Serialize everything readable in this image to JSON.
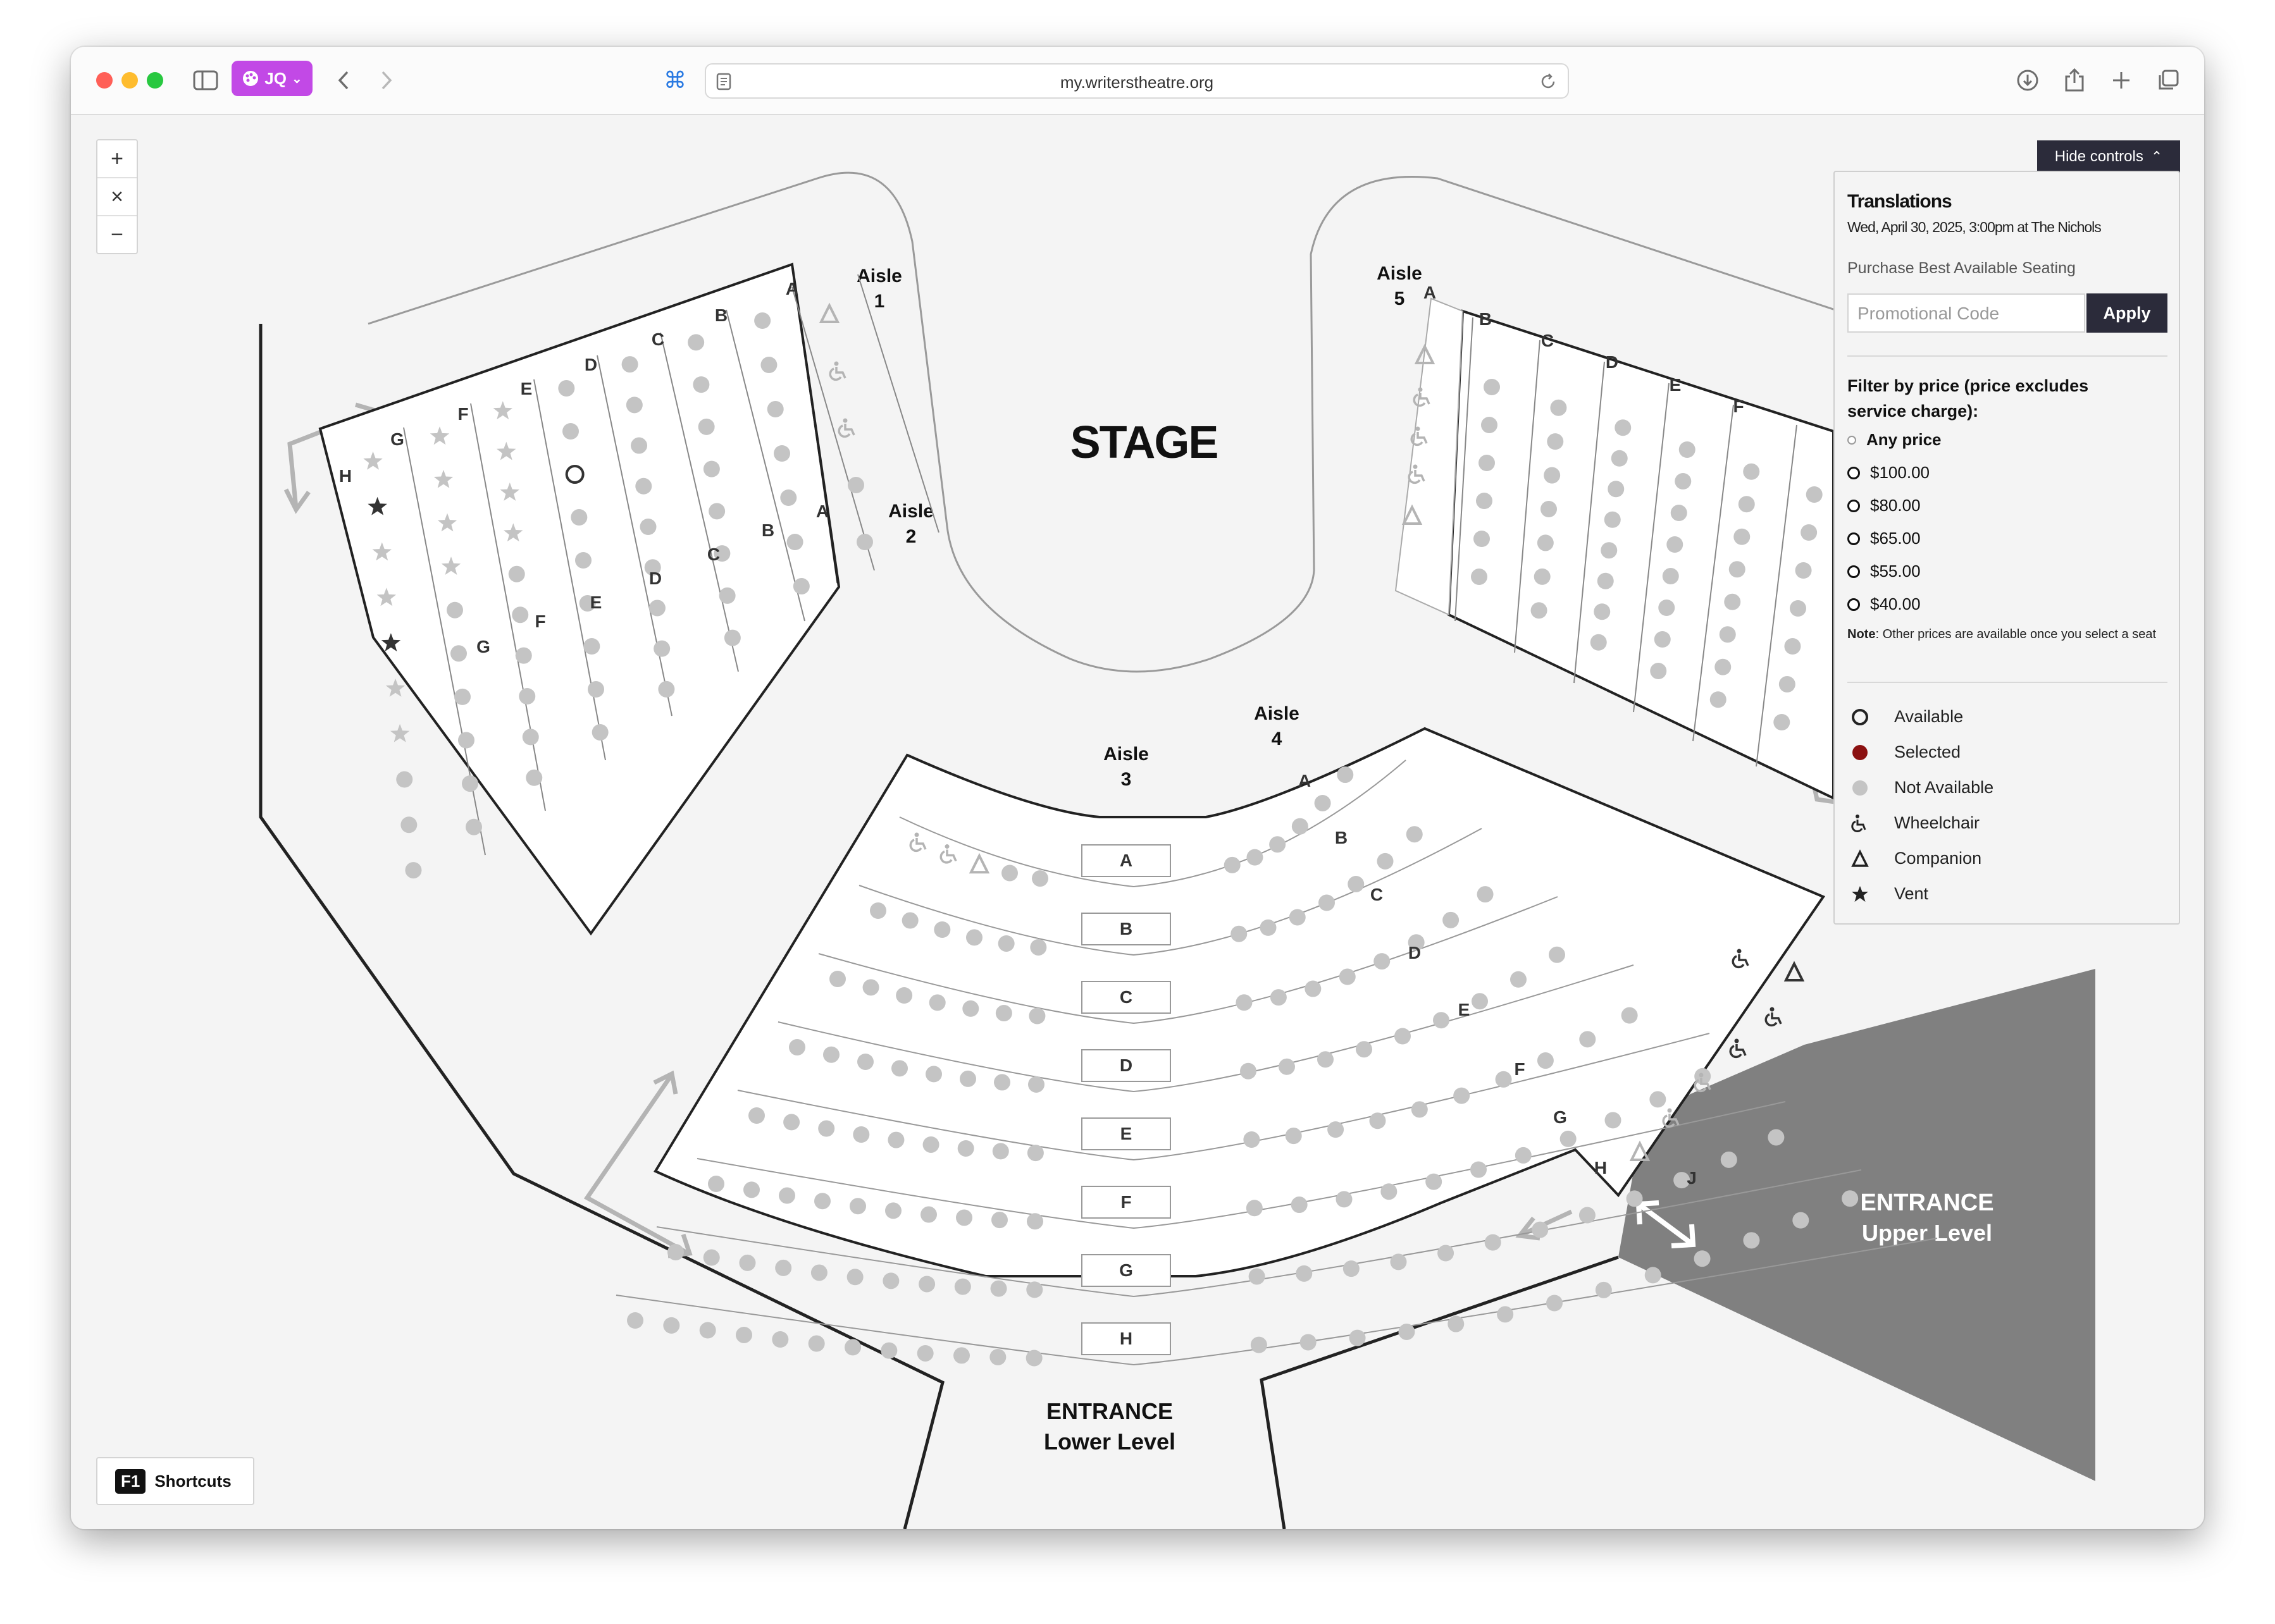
{
  "browser": {
    "url": "my.writerstheatre.org",
    "profile_label": "JQ",
    "profile_chevron": "⌄",
    "window_controls": {
      "close_color": "#ff5f57",
      "minimize_color": "#febc2e",
      "zoom_color": "#28c840"
    }
  },
  "map": {
    "zoom_in": "+",
    "reset": "×",
    "zoom_out": "−",
    "stage": "STAGE",
    "aisles": [
      {
        "line1": "Aisle",
        "line2": "1"
      },
      {
        "line1": "Aisle",
        "line2": "2"
      },
      {
        "line1": "Aisle",
        "line2": "3"
      },
      {
        "line1": "Aisle",
        "line2": "4"
      },
      {
        "line1": "Aisle",
        "line2": "5"
      }
    ],
    "entrance_upper": {
      "line1": "ENTRANCE",
      "line2": "Upper Level"
    },
    "entrance_lower": {
      "line1": "ENTRANCE",
      "line2": "Lower Level"
    },
    "left_section_rows": [
      "A",
      "B",
      "C",
      "D",
      "E",
      "F",
      "G",
      "H"
    ],
    "left_lower_rows": [
      "A",
      "B",
      "C",
      "D",
      "E",
      "F",
      "G"
    ],
    "center_rows": [
      "A",
      "B",
      "C",
      "D",
      "E",
      "F",
      "G",
      "H"
    ],
    "center_right_rows": [
      "A",
      "B",
      "C",
      "D",
      "E",
      "F",
      "G",
      "H",
      "J"
    ],
    "right_section_rows": [
      "A",
      "B",
      "C",
      "D",
      "E",
      "F"
    ]
  },
  "controls": {
    "hide_label": "Hide controls",
    "hide_chevron": "⌃",
    "show_title": "Translations",
    "show_datetime": "Wed, April 30, 2025, 3:00pm at The Nichols",
    "best_seating_link": "Purchase Best Available Seating",
    "promo_placeholder": "Promotional Code",
    "apply_label": "Apply",
    "filter_label": "Filter by price (price excludes service charge):",
    "price_options": [
      "Any price",
      "$100.00",
      "$80.00",
      "$65.00",
      "$55.00",
      "$40.00"
    ],
    "note_bold": "Note",
    "note_text": ": Other prices are available once you select a seat",
    "legend": [
      "Available",
      "Selected",
      "Not Available",
      "Wheelchair",
      "Companion",
      "Vent"
    ],
    "legend_selected_color": "#8b1010"
  },
  "shortcuts": {
    "key": "F1",
    "label": "Shortcuts"
  }
}
